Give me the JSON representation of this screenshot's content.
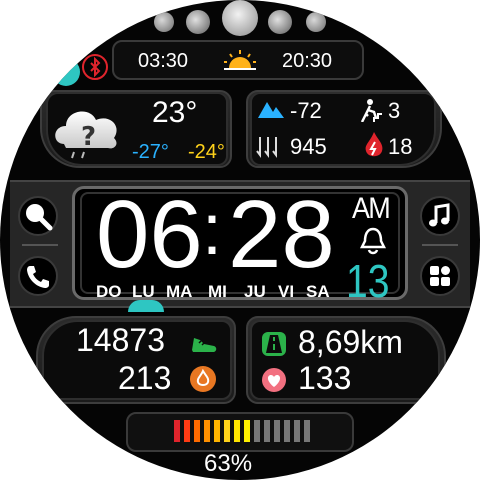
{
  "top": {
    "sunrise": "03:30",
    "sunset": "20:30"
  },
  "weather": {
    "temp": "23°",
    "temp_low": "-27°",
    "temp_high": "-24°"
  },
  "stats": {
    "altitude": "-72",
    "floors": "3",
    "pressure": "945",
    "calories_burn": "18"
  },
  "time": {
    "hours": "06",
    "separator": ":",
    "minutes": "28",
    "ampm": "AM",
    "date": "13"
  },
  "weekdays": [
    "DO",
    "LU",
    "MA",
    "MI",
    "JU",
    "VI",
    "SA"
  ],
  "active_day_index": 1,
  "activity": {
    "steps": "14873",
    "floors_climbed": "213",
    "distance": "8,69km",
    "heart_rate": "133"
  },
  "battery": {
    "percent_label": "63%",
    "level": 0.63
  },
  "icons": {
    "moons": [
      "moon-waxing-crescent-icon",
      "moon-half-icon",
      "moon-full-icon",
      "moon-gibbous-icon",
      "moon-crescent-icon"
    ],
    "bluetooth": "bluetooth-icon",
    "sun": "sunrise-icon",
    "weather": "cloud-question-icon",
    "search": "search-icon",
    "phone": "phone-icon",
    "music": "music-note-icon",
    "apps": "apps-grid-icon"
  },
  "colors": {
    "accent": "#2ec6c2",
    "cold": "#2ab2ff",
    "warm": "#ffd21a",
    "red": "#e0242c",
    "green": "#2bb24a"
  }
}
